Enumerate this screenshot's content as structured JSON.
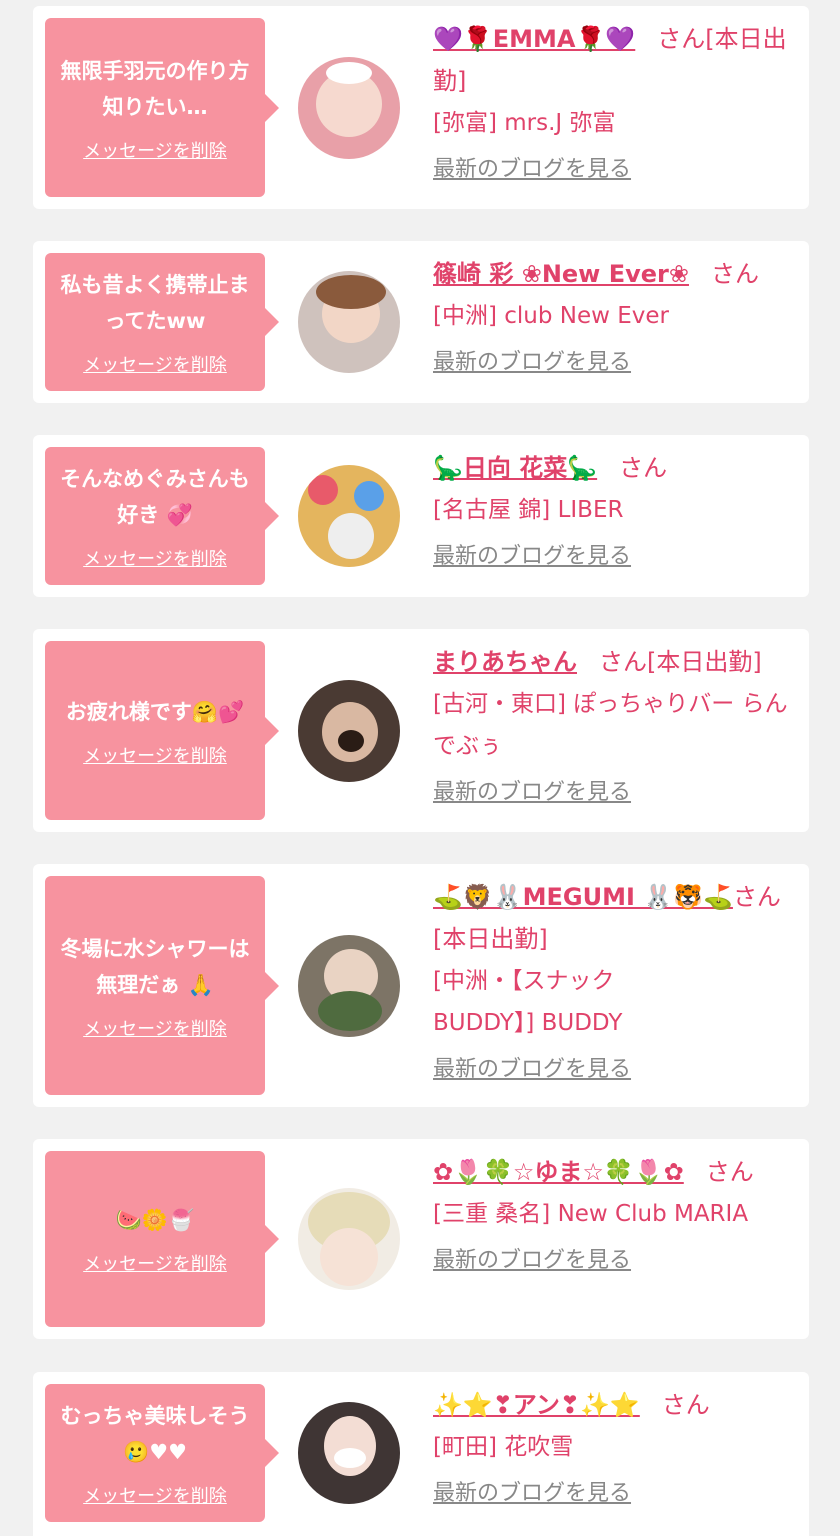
{
  "common": {
    "delete_label": "メッセージを削除",
    "blog_label": "最新のブログを見る",
    "san_label": "さん"
  },
  "colors": {
    "page_bg": "#f1f1f1",
    "bubble": "#f7939f",
    "accent": "#e0426a",
    "link_gray": "#888888"
  },
  "cards": [
    {
      "message": "無限手羽元の作り方知りたい…",
      "name": "💜🌹EMMA🌹💜",
      "status": "さん[本日出勤]",
      "shop": "[弥富] mrs.J 弥富"
    },
    {
      "message": "私も昔よく携帯止まってたww",
      "name": "篠崎 彩 ❀New Ever❀",
      "status": "さん",
      "shop": "[中洲] club New Ever"
    },
    {
      "message": "そんなめぐみさんも好き 💞",
      "name": "🦕日向 花菜🦕",
      "status": "さん",
      "shop": "[名古屋 錦] LIBER"
    },
    {
      "message": "お疲れ様です🤗💕",
      "name": "まりあちゃん",
      "status": "さん[本日出勤]",
      "shop": "[古河・東口] ぽっちゃりバー らんでぶぅ"
    },
    {
      "message": "冬場に水シャワーは無理だぁ 🙏",
      "name": "⛳🦁🐰MEGUMI 🐰🐯⛳",
      "status": "さん[本日出勤]",
      "shop": "[中洲・【スナックBUDDY】] BUDDY"
    },
    {
      "message": "🍉🌼🍧",
      "name": "✿🌷🍀☆ゆま☆🍀🌷✿",
      "status": "さん",
      "shop": "[三重 桑名] New Club MARIA"
    },
    {
      "message": "むっちゃ美味しそう🥲♥♥",
      "name": "✨⭐❣アン❣✨⭐",
      "status": "さん",
      "shop": "[町田] 花吹雪"
    }
  ]
}
